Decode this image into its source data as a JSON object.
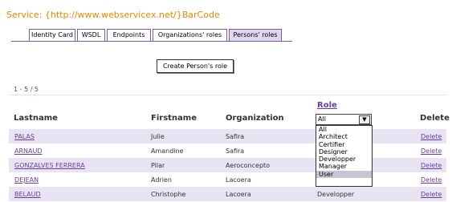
{
  "service_title": "Service: {http://www.webservicex.net/}BarCode",
  "tabs": [
    {
      "label": "Identity Card"
    },
    {
      "label": "WSDL"
    },
    {
      "label": "Endpoints"
    },
    {
      "label": "Organizations' roles"
    },
    {
      "label": "Persons' roles"
    }
  ],
  "create_button": "Create Person's role",
  "range_text": "1 - 5 / 5",
  "columns": {
    "lastname": "Lastname",
    "firstname": "Firstname",
    "organization": "Organization",
    "role": "Role",
    "delete": "Delete"
  },
  "role_filter": {
    "selected": "All",
    "options": [
      "All",
      "Architect",
      "Certifier",
      "Designer",
      "Developper",
      "Manager",
      "User"
    ],
    "highlighted": "User"
  },
  "rows": [
    {
      "lastname": "PALAS",
      "firstname": "Julie",
      "organization": "Safira",
      "role": "",
      "delete": "Delete"
    },
    {
      "lastname": "ARNAUD",
      "firstname": "Amandine",
      "organization": "Safira",
      "role": "",
      "delete": "Delete"
    },
    {
      "lastname": "GONZALVES FERRERA",
      "firstname": "Pilar",
      "organization": "Aeroconcepto",
      "role": "",
      "delete": "Delete"
    },
    {
      "lastname": "DEJEAN",
      "firstname": "Adrien",
      "organization": "Lacoera",
      "role": "",
      "delete": "Delete"
    },
    {
      "lastname": "BELAUD",
      "firstname": "Christophe",
      "organization": "Lacoera",
      "role": "Developper",
      "delete": "Delete"
    }
  ]
}
